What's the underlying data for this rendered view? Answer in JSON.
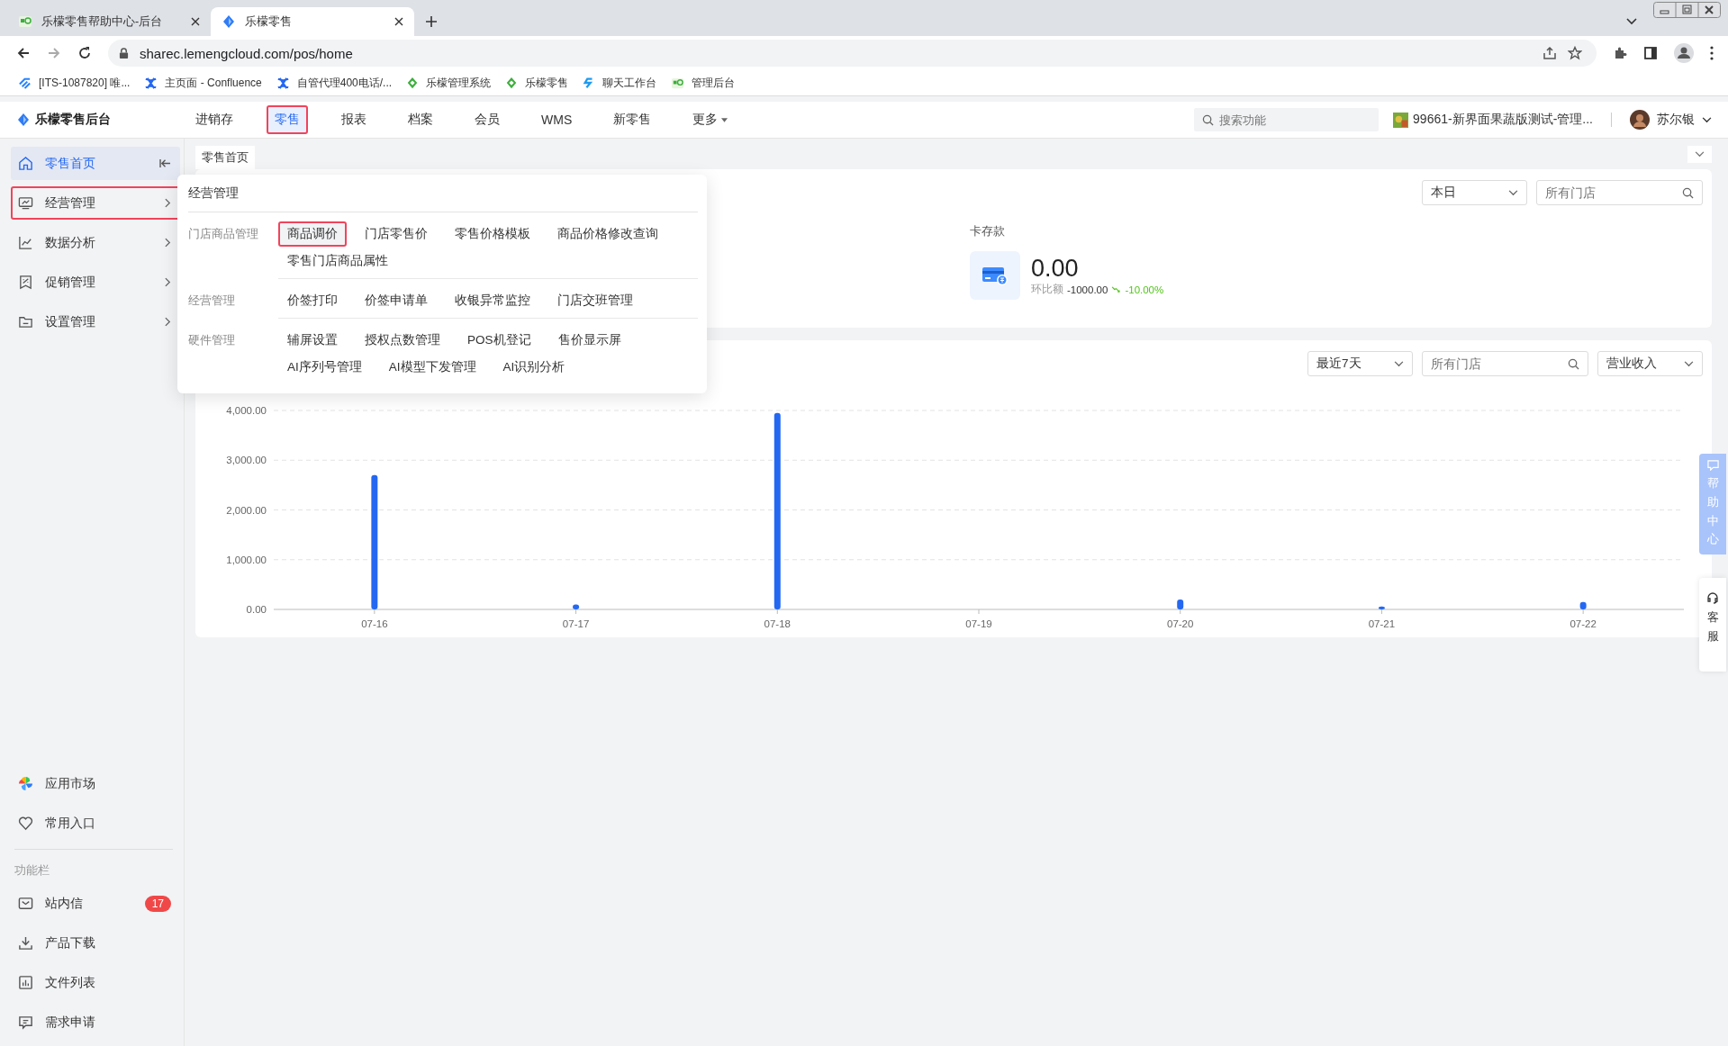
{
  "browser": {
    "tabs": [
      {
        "title": "乐檬零售帮助中心-后台",
        "selected": false
      },
      {
        "title": "乐檬零售",
        "selected": true
      }
    ],
    "url": "sharec.lemengcloud.com/pos/home",
    "bookmarks": [
      {
        "label": "[ITS-1087820] 唯..."
      },
      {
        "label": "主页面 - Confluence"
      },
      {
        "label": "自管代理400电话/..."
      },
      {
        "label": "乐檬管理系统"
      },
      {
        "label": "乐檬零售"
      },
      {
        "label": "聊天工作台"
      },
      {
        "label": "管理后台"
      }
    ]
  },
  "header": {
    "brand": "乐檬零售后台",
    "nav": [
      {
        "label": "进销存",
        "selected": false,
        "outlined": false
      },
      {
        "label": "零售",
        "selected": true,
        "outlined": true
      },
      {
        "label": "报表",
        "selected": false,
        "outlined": false
      },
      {
        "label": "档案",
        "selected": false,
        "outlined": false
      },
      {
        "label": "会员",
        "selected": false,
        "outlined": false
      },
      {
        "label": "WMS",
        "selected": false,
        "outlined": false
      },
      {
        "label": "新零售",
        "selected": false,
        "outlined": false
      }
    ],
    "more": "更多",
    "search": {
      "placeholder": "搜索功能"
    },
    "store": "99661-新界面果蔬版测试-管理...",
    "user": "苏尔银"
  },
  "sidebar": {
    "items": [
      {
        "label": "零售首页",
        "selected": true,
        "outlined": false,
        "arrow": false
      },
      {
        "label": "经营管理",
        "selected": false,
        "outlined": true,
        "arrow": true
      },
      {
        "label": "数据分析",
        "selected": false,
        "outlined": false,
        "arrow": true
      },
      {
        "label": "促销管理",
        "selected": false,
        "outlined": false,
        "arrow": true
      },
      {
        "label": "设置管理",
        "selected": false,
        "outlined": false,
        "arrow": true
      }
    ],
    "shortcuts": [
      {
        "label": "应用市场"
      },
      {
        "label": "常用入口"
      }
    ],
    "section": "功能栏",
    "tools": [
      {
        "label": "站内信",
        "badge": "17"
      },
      {
        "label": "产品下载"
      },
      {
        "label": "文件列表"
      },
      {
        "label": "需求申请"
      }
    ]
  },
  "menu": {
    "title": "经营管理",
    "groups": [
      {
        "label": "门店商品管理",
        "links": [
          {
            "label": "商品调价",
            "outlined": true
          },
          {
            "label": "门店零售价",
            "outlined": false
          },
          {
            "label": "零售价格模板",
            "outlined": false
          },
          {
            "label": "商品价格修改查询",
            "outlined": false
          },
          {
            "label": "零售门店商品属性",
            "outlined": false
          }
        ]
      },
      {
        "label": "经营管理",
        "links": [
          {
            "label": "价签打印",
            "outlined": false
          },
          {
            "label": "价签申请单",
            "outlined": false
          },
          {
            "label": "收银异常监控",
            "outlined": false
          },
          {
            "label": "门店交班管理",
            "outlined": false
          }
        ]
      },
      {
        "label": "硬件管理",
        "links": [
          {
            "label": "辅屏设置",
            "outlined": false
          },
          {
            "label": "授权点数管理",
            "outlined": false
          },
          {
            "label": "POS机登记",
            "outlined": false
          },
          {
            "label": "售价显示屏",
            "outlined": false
          },
          {
            "label": "AI序列号管理",
            "outlined": false
          },
          {
            "label": "AI模型下发管理",
            "outlined": false
          },
          {
            "label": "AI识别分析",
            "outlined": false
          }
        ]
      }
    ]
  },
  "page_tab": "零售首页",
  "summary": {
    "period": "本日",
    "store": {
      "placeholder": "所有门店"
    },
    "metric": {
      "label": "卡存款",
      "value": "0.00",
      "compare_label": "环比额",
      "compare_value": "-1000.00",
      "change": "-10.00%"
    }
  },
  "trend": {
    "period": "最近7天",
    "store": {
      "placeholder": "所有门店"
    },
    "measure": "营业收入",
    "chart_data": {
      "type": "bar",
      "categories": [
        "07-16",
        "07-17",
        "07-18",
        "07-19",
        "07-20",
        "07-21",
        "07-22"
      ],
      "series": [
        {
          "color": "#2468f2",
          "values": [
            2700,
            100,
            3950,
            0,
            200,
            60,
            150
          ]
        }
      ],
      "grid": true,
      "ylim": [
        0,
        4000
      ],
      "yticks": [
        {
          "value": 0,
          "label": "0.00"
        },
        {
          "value": 1000,
          "label": "1,000.00"
        },
        {
          "value": 2000,
          "label": "2,000.00"
        },
        {
          "value": 3000,
          "label": "3,000.00"
        },
        {
          "value": 4000,
          "label": "4,000.00"
        }
      ]
    }
  },
  "float": {
    "help": "帮助中心",
    "service": "客服"
  }
}
